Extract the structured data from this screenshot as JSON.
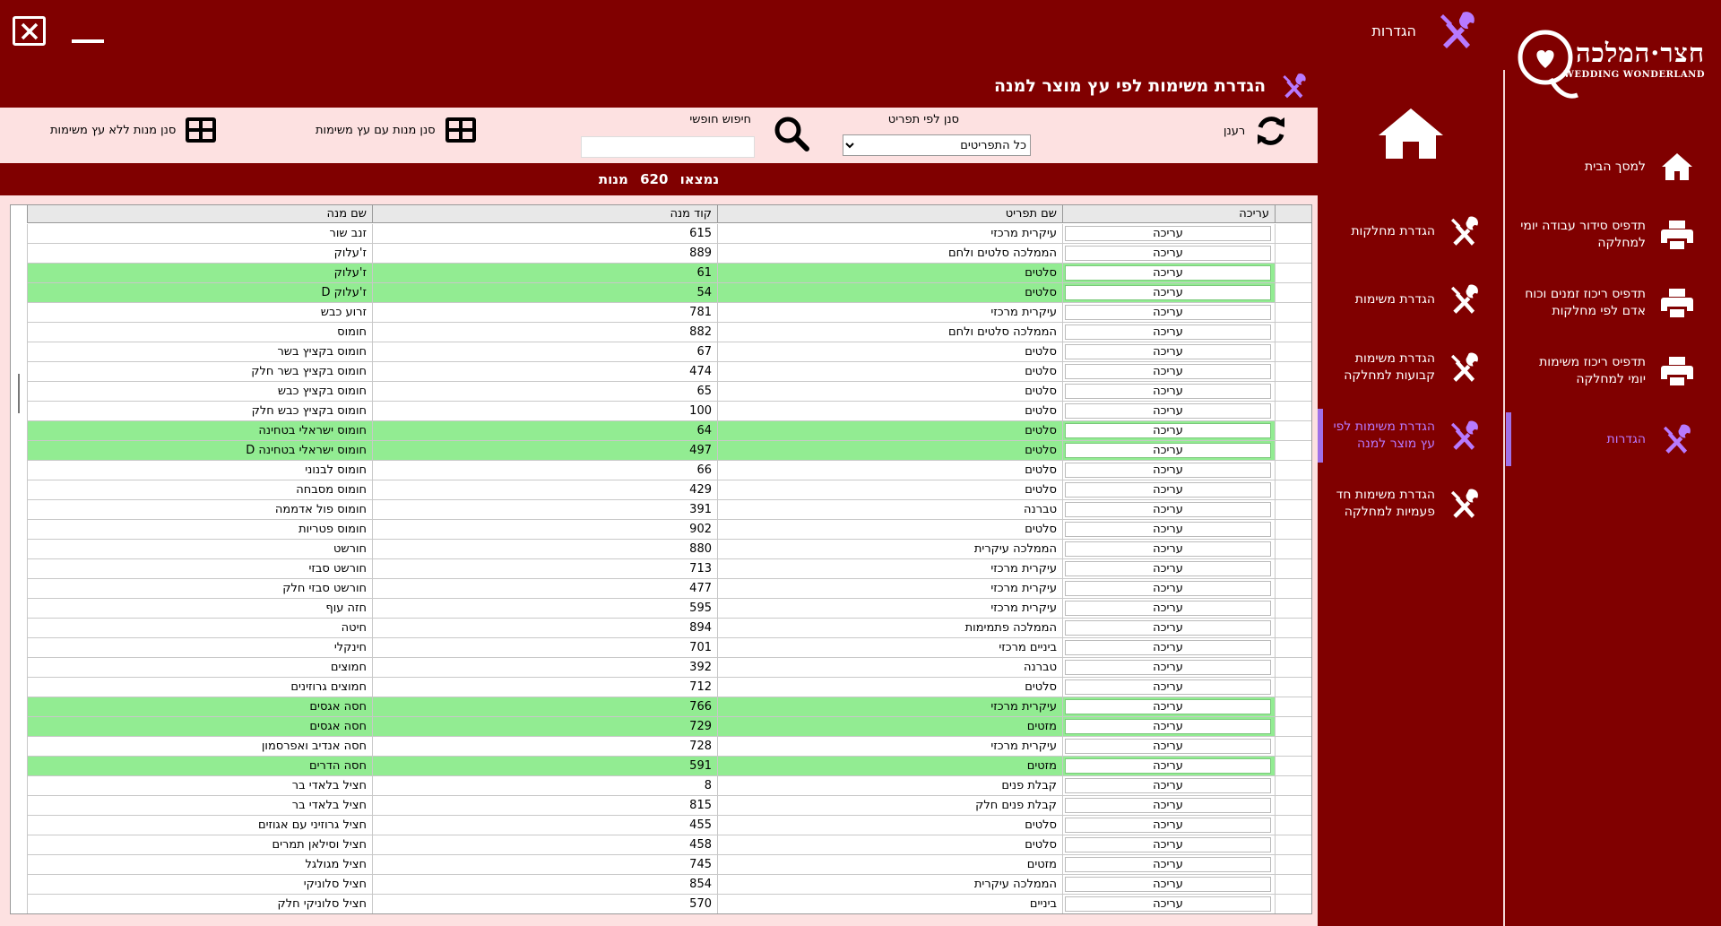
{
  "header": {
    "settings_label": "הגדרות",
    "logo_hebrew": "חצר·המלכה",
    "logo_english": "WEDDING WONDERLAND"
  },
  "sidebar": {
    "items": [
      {
        "label": "למסך הבית",
        "icon": "home-icon"
      },
      {
        "label": "תדפיס סידור עבודה יומי למחלקה",
        "icon": "printer-icon"
      },
      {
        "label": "תדפיס ריכוז זמנים וכוח אדם לפי מחלקות",
        "icon": "printer-icon"
      },
      {
        "label": "תדפיס ריכוז משימות יומי למחלקה",
        "icon": "printer-icon"
      },
      {
        "label": "הגדרות",
        "icon": "tools-icon",
        "active": true
      }
    ]
  },
  "settings_nav": {
    "items": [
      {
        "label": "הגדרת מחלקות"
      },
      {
        "label": "הגדרת משימות"
      },
      {
        "label": "הגדרת משימות קבועות למחלקה"
      },
      {
        "label": "הגדרת משימות לפי עץ מוצר למנה",
        "active": true
      },
      {
        "label": "הגדרת משימות חד פעמיות למחלקה"
      }
    ]
  },
  "page": {
    "title": "הגדרת משימות לפי עץ מוצר למנה"
  },
  "toolbar": {
    "refresh_label": "רענן",
    "filter_menu_label": "סנן לפי תפריט",
    "filter_menu_value": "כל התפריטים",
    "free_search_label": "חיפוש חופשי",
    "free_search_value": "",
    "filter_with_tree_label": "סנן מנות עם עץ משימות",
    "filter_without_tree_label": "סנן מנות ללא עץ משימות"
  },
  "count": {
    "prefix": "נמצאו",
    "value": "620",
    "suffix": "מנות"
  },
  "grid": {
    "columns": {
      "edit": "עריכה",
      "menu": "שם תפריט",
      "code": "קוד מנה",
      "name": "שם מנה"
    },
    "edit_label": "עריכה",
    "rows": [
      {
        "menu": "עיקרית מרכזי",
        "code": "615",
        "name": "זנב שור",
        "hl": false
      },
      {
        "menu": "הממלכה סלטים ולחם",
        "code": "889",
        "name": "ז'עלוק",
        "hl": false
      },
      {
        "menu": "סלטים",
        "code": "61",
        "name": "ז'עלוק",
        "hl": true
      },
      {
        "menu": "סלטים",
        "code": "54",
        "name": "ז'עלוק D",
        "hl": true
      },
      {
        "menu": "עיקרית מרכזי",
        "code": "781",
        "name": "זרוע כבש",
        "hl": false
      },
      {
        "menu": "הממלכה סלטים ולחם",
        "code": "882",
        "name": "חומוס",
        "hl": false
      },
      {
        "menu": "סלטים",
        "code": "67",
        "name": "חומוס בקציץ בשר",
        "hl": false
      },
      {
        "menu": "סלטים",
        "code": "474",
        "name": "חומוס בקציץ בשר חלק",
        "hl": false
      },
      {
        "menu": "סלטים",
        "code": "65",
        "name": "חומוס בקציץ כבש",
        "hl": false
      },
      {
        "menu": "סלטים",
        "code": "100",
        "name": "חומוס בקציץ כבש חלק",
        "hl": false
      },
      {
        "menu": "סלטים",
        "code": "64",
        "name": "חומוס ישראלי בטחינה",
        "hl": true
      },
      {
        "menu": "סלטים",
        "code": "497",
        "name": "חומוס ישראלי בטחינה D",
        "hl": true
      },
      {
        "menu": "סלטים",
        "code": "66",
        "name": "חומוס לבנוני",
        "hl": false
      },
      {
        "menu": "סלטים",
        "code": "429",
        "name": "חומוס מסבחה",
        "hl": false
      },
      {
        "menu": "טברנה",
        "code": "391",
        "name": "חומוס פול אדממה",
        "hl": false
      },
      {
        "menu": "סלטים",
        "code": "902",
        "name": "חומוס פטריות",
        "hl": false
      },
      {
        "menu": "הממלכה עיקרית",
        "code": "880",
        "name": "חורשט",
        "hl": false
      },
      {
        "menu": "עיקרית מרכזי",
        "code": "713",
        "name": "חורשט סבזי",
        "hl": false
      },
      {
        "menu": "עיקרית מרכזי",
        "code": "477",
        "name": "חורשט סבזי חלק",
        "hl": false
      },
      {
        "menu": "עיקרית מרכזי",
        "code": "595",
        "name": "חזה עוף",
        "hl": false
      },
      {
        "menu": "הממלכה פתמימות",
        "code": "894",
        "name": "חיטה",
        "hl": false
      },
      {
        "menu": "ביניים מרכזי",
        "code": "701",
        "name": "חינקלי",
        "hl": false
      },
      {
        "menu": "טברנה",
        "code": "392",
        "name": "חמוצים",
        "hl": false
      },
      {
        "menu": "סלטים",
        "code": "712",
        "name": "חמוצים גרוזינים",
        "hl": false
      },
      {
        "menu": "עיקרית מרכזי",
        "code": "766",
        "name": "חסה אגסים",
        "hl": true
      },
      {
        "menu": "מזטים",
        "code": "729",
        "name": "חסה אגסים",
        "hl": true
      },
      {
        "menu": "עיקרית מרכזי",
        "code": "728",
        "name": "חסה אנדיב ואפרסמון",
        "hl": false
      },
      {
        "menu": "מזטים",
        "code": "591",
        "name": "חסה הדרים",
        "hl": true
      },
      {
        "menu": "קבלת פנים",
        "code": "8",
        "name": "חציל בלאדי בר",
        "hl": false
      },
      {
        "menu": "קבלת פנים חלק",
        "code": "815",
        "name": "חציל בלאדי בר",
        "hl": false
      },
      {
        "menu": "סלטים",
        "code": "455",
        "name": "חציל גרוזיני עם אגוזים",
        "hl": false
      },
      {
        "menu": "סלטים",
        "code": "458",
        "name": "חציל וסילאן תמרים",
        "hl": false
      },
      {
        "menu": "מזטים",
        "code": "745",
        "name": "חציל מגולגל",
        "hl": false
      },
      {
        "menu": "הממלכה עיקרית",
        "code": "854",
        "name": "חציל סלוניקי",
        "hl": false
      },
      {
        "menu": "ביניים",
        "code": "570",
        "name": "חציל סלוניקי חלק",
        "hl": false
      }
    ]
  }
}
